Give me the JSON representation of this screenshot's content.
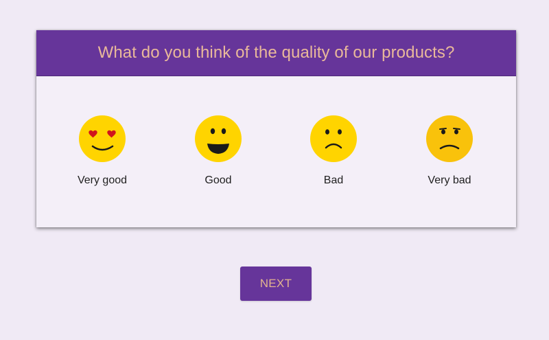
{
  "survey": {
    "question": "What do you think of the quality of our products?",
    "options": [
      {
        "label": "Very good",
        "icon": "heart-eyes-face-icon"
      },
      {
        "label": "Good",
        "icon": "smiling-face-icon"
      },
      {
        "label": "Bad",
        "icon": "frowning-face-icon"
      },
      {
        "label": "Very bad",
        "icon": "angry-face-icon"
      }
    ]
  },
  "actions": {
    "next_label": "NEXT"
  },
  "colors": {
    "background": "#f0eaf5",
    "header": "#66359a",
    "title_text": "#e9b99a",
    "button_text": "#e2b48f",
    "face_yellow": "#ffd200",
    "face_orange": "#f9c20b",
    "heart_red": "#d0141c"
  }
}
